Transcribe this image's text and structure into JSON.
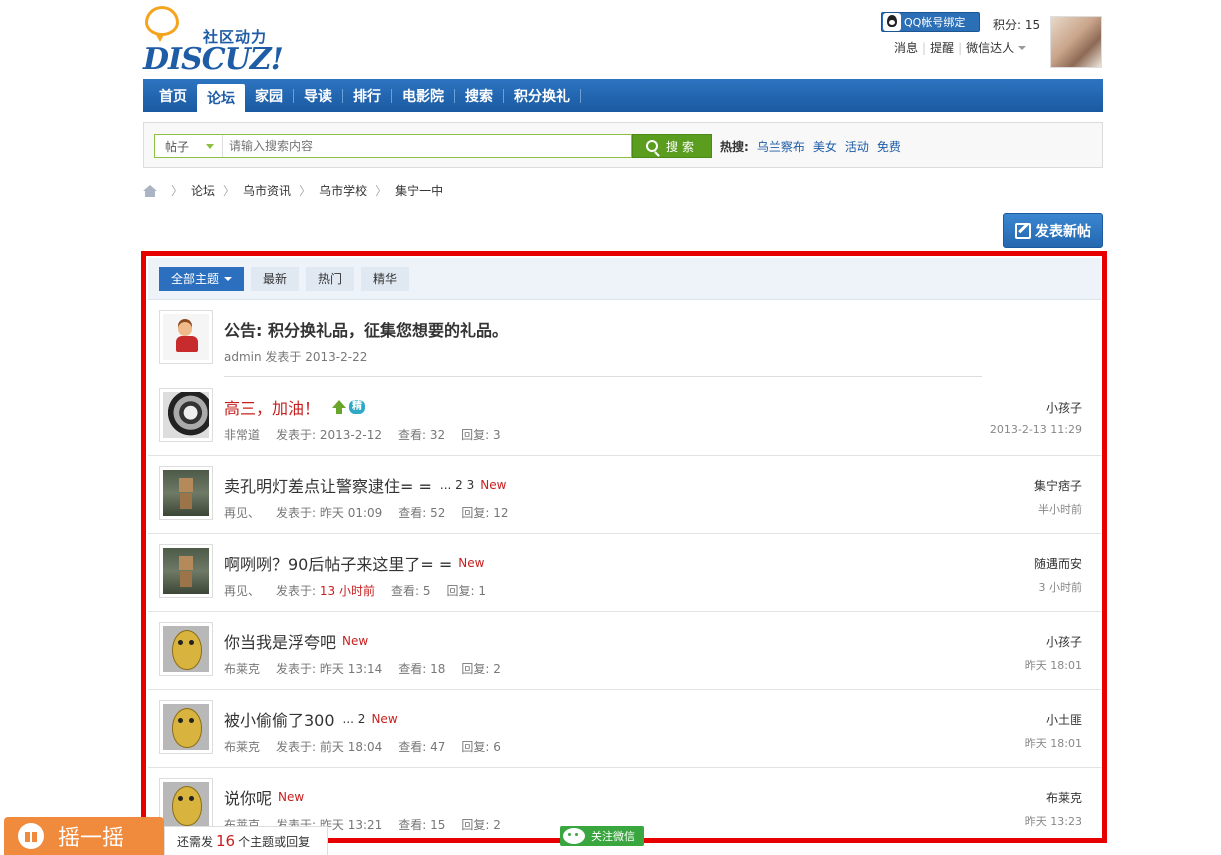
{
  "header": {
    "logo_cn": "社区动力",
    "logo_en": "DISCUZ!",
    "qq_bind": "QQ帐号绑定",
    "points": "积分: 15",
    "links": [
      "消息",
      "提醒",
      "微信达人"
    ]
  },
  "nav": {
    "items": [
      {
        "label": "首页",
        "active": false
      },
      {
        "label": "论坛",
        "active": true
      },
      {
        "label": "家园",
        "active": false
      },
      {
        "label": "导读",
        "active": false
      },
      {
        "label": "排行",
        "active": false
      },
      {
        "label": "电影院",
        "active": false
      },
      {
        "label": "搜索",
        "active": false
      },
      {
        "label": "积分换礼",
        "active": false
      }
    ]
  },
  "search": {
    "type": "帖子",
    "placeholder": "请输入搜索内容",
    "button": "搜索",
    "hot_label": "热搜:",
    "hot_terms": [
      "乌兰察布",
      "美女",
      "活动",
      "免费"
    ]
  },
  "breadcrumb": [
    "论坛",
    "乌市资讯",
    "乌市学校",
    "集宁一中"
  ],
  "post_button": "发表新帖",
  "filters": [
    "全部主题",
    "最新",
    "热门",
    "精华"
  ],
  "announcement": {
    "title": "公告: 积分换礼品，征集您想要的礼品。",
    "meta": "admin 发表于 2013-2-22"
  },
  "threads": [
    {
      "title": "高三，加油！",
      "style": "red",
      "pages": "",
      "new": "",
      "badges": true,
      "author": "非常道",
      "posted": "发表于: 2013-2-12",
      "posted_hl": false,
      "views": "查看: 32",
      "replies": "回复: 3",
      "last_user": "小孩子",
      "last_time": "2013-2-13 11:29",
      "pic": "bw"
    },
    {
      "title": "卖孔明灯差点让警察逮住= =",
      "style": "normal",
      "pages": "... 2  3",
      "new": "New",
      "badges": false,
      "author": "再见、",
      "posted": "发表于: 昨天 01:09",
      "posted_hl": false,
      "views": "查看: 52",
      "replies": "回复: 12",
      "last_user": "集宁痞子",
      "last_time": "半小时前",
      "pic": "box"
    },
    {
      "title": "啊咧咧？90后帖子来这里了= =",
      "style": "normal",
      "pages": "",
      "new": "New",
      "badges": false,
      "author": "再见、",
      "posted": "发表于: ",
      "posted_hl_text": "13 小时前",
      "posted_hl": true,
      "views": "查看: 5",
      "replies": "回复: 1",
      "last_user": "随遇而安",
      "last_time": "3 小时前",
      "pic": "box"
    },
    {
      "title": "你当我是浮夸吧",
      "style": "normal",
      "pages": "",
      "new": "New",
      "badges": false,
      "author": "布莱克",
      "posted": "发表于: 昨天 13:14",
      "posted_hl": false,
      "views": "查看: 18",
      "replies": "回复: 2",
      "last_user": "小孩子",
      "last_time": "昨天 18:01",
      "pic": "potato"
    },
    {
      "title": "被小偷偷了300",
      "style": "normal",
      "pages": "... 2",
      "new": "New",
      "badges": false,
      "author": "布莱克",
      "posted": "发表于: 前天 18:04",
      "posted_hl": false,
      "views": "查看: 47",
      "replies": "回复: 6",
      "last_user": "小土匪",
      "last_time": "昨天 18:01",
      "pic": "potato"
    },
    {
      "title": "说你呢",
      "style": "normal",
      "pages": "",
      "new": "New",
      "badges": false,
      "author": "布莱克",
      "posted": "发表于: 昨天 13:21",
      "posted_hl": false,
      "views": "查看: 15",
      "replies": "回复: 2",
      "last_user": "布莱克",
      "last_time": "昨天 13:23",
      "pic": "potato"
    }
  ],
  "bottom": {
    "shake": "摇一摇",
    "remain_prefix": "还需发",
    "remain_num": "16",
    "remain_suffix": "个主题或回复",
    "wechat_follow": "关注微信"
  },
  "colors": {
    "nav_blue": "#1a5aa2",
    "search_green": "#5a9d1f",
    "highlight_red": "#c81e1e",
    "frame_red": "#e60000"
  }
}
